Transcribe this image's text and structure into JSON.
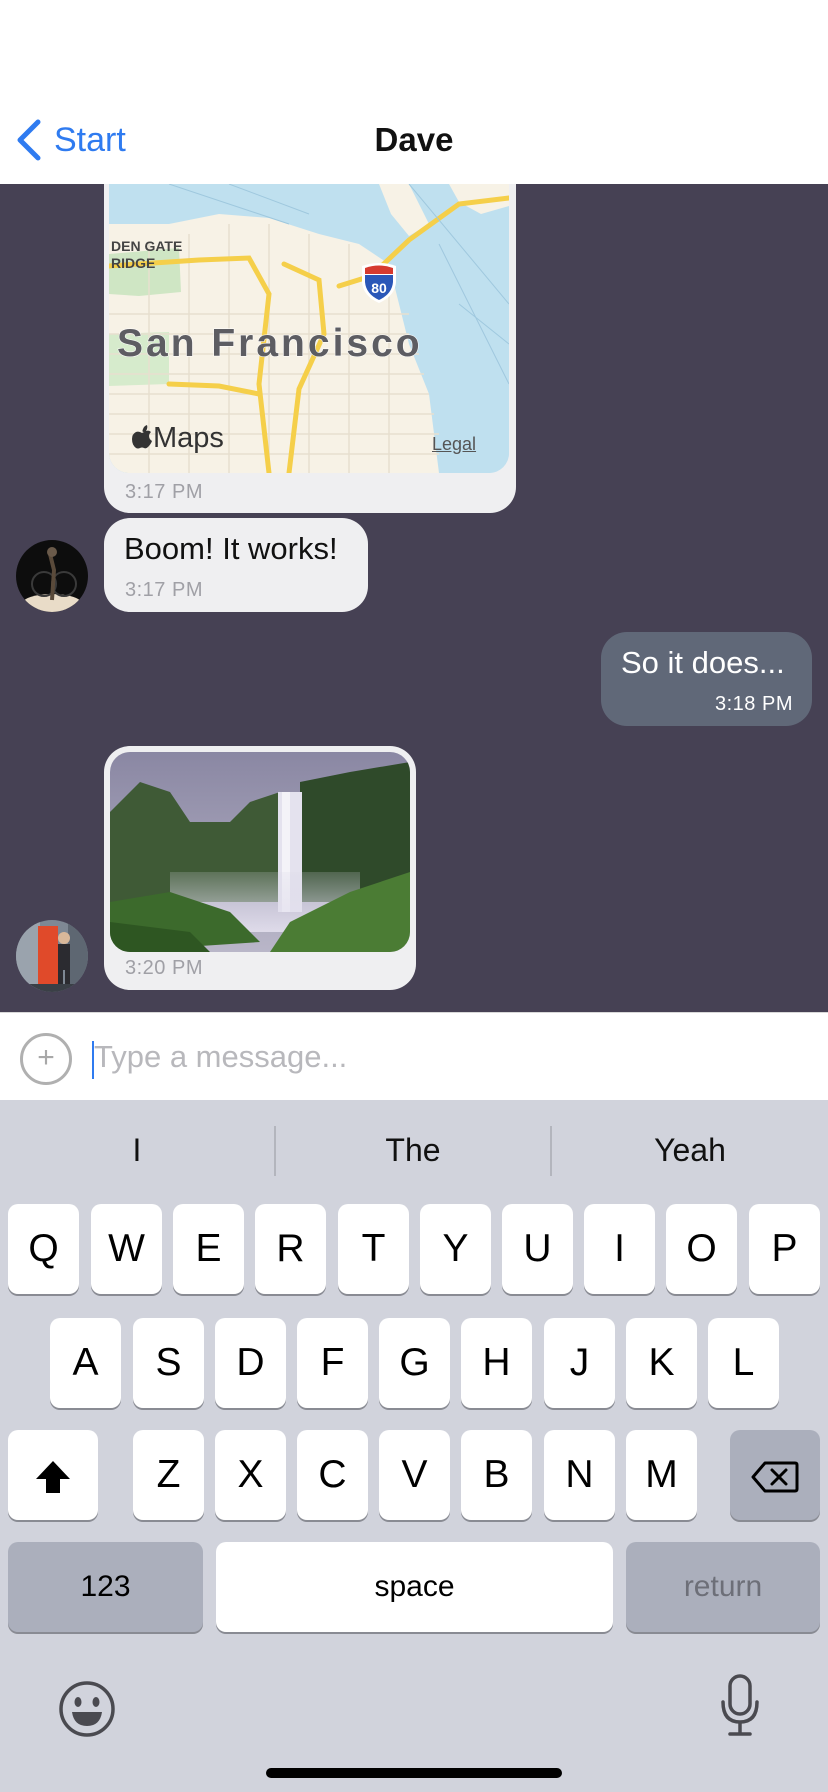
{
  "nav": {
    "back_label": "Start",
    "title": "Dave"
  },
  "map_message": {
    "map_label": "San Francisco",
    "bridge_label_line1": "DEN GATE",
    "bridge_label_line2": "RIDGE",
    "highway_shield": "80",
    "brand": "Maps",
    "legal": "Legal",
    "time": "3:17 PM"
  },
  "messages": [
    {
      "direction": "incoming",
      "text": "Boom! It works!",
      "time": "3:17 PM"
    },
    {
      "direction": "outgoing",
      "text": "So it does...",
      "time": "3:18 PM"
    }
  ],
  "photo_message": {
    "time": "3:20 PM"
  },
  "composer": {
    "placeholder": "Type a message...",
    "attach_icon": "plus-circle-icon"
  },
  "keyboard": {
    "suggestions": [
      "I",
      "The",
      "Yeah"
    ],
    "row1": [
      "Q",
      "W",
      "E",
      "R",
      "T",
      "Y",
      "U",
      "I",
      "O",
      "P"
    ],
    "row2": [
      "A",
      "S",
      "D",
      "F",
      "G",
      "H",
      "J",
      "K",
      "L"
    ],
    "row3": [
      "Z",
      "X",
      "C",
      "V",
      "B",
      "N",
      "M"
    ],
    "numbers_key": "123",
    "space_key": "space",
    "return_key": "return",
    "shift_icon": "shift-icon",
    "delete_icon": "delete-icon",
    "emoji_icon": "emoji-icon",
    "mic_icon": "microphone-icon"
  },
  "colors": {
    "accent": "#2f7bf0",
    "chat_background": "#464154",
    "incoming_bubble": "#efeff1",
    "outgoing_bubble": "#606878",
    "keyboard_background": "#d1d3dc"
  }
}
